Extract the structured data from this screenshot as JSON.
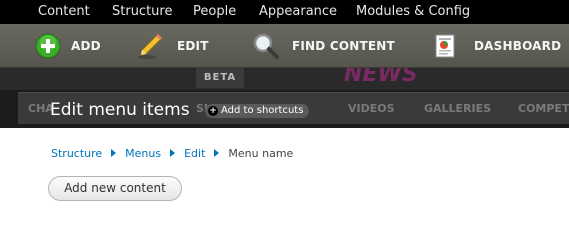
{
  "admin_menu": {
    "items": [
      "Content",
      "Structure",
      "People",
      "Appearance",
      "Modules & Config"
    ]
  },
  "toolbar": {
    "items": [
      {
        "label": "ADD",
        "icon": "plus-circle-icon"
      },
      {
        "label": "EDIT",
        "icon": "pencil-icon"
      },
      {
        "label": "FIND CONTENT",
        "icon": "magnifier-icon"
      },
      {
        "label": "DASHBOARD",
        "icon": "dashboard-icon"
      }
    ]
  },
  "background_site": {
    "beta": "BETA",
    "logo": "NEWS",
    "nav": [
      "CHA",
      "SI",
      "VIDEOS",
      "GALLERIES",
      "COMPETITI"
    ]
  },
  "overlay": {
    "title": "Edit menu items",
    "add_to_shortcuts": "Add to shortcuts",
    "breadcrumb": [
      "Structure",
      "Menus",
      "Edit",
      "Menu name"
    ],
    "add_new_content": "Add new content"
  },
  "colors": {
    "link": "#0074bd",
    "admin_menu_bg": "#000000",
    "toolbar_bg": "#5f5f57",
    "add_icon_green": "#3cab2a"
  }
}
